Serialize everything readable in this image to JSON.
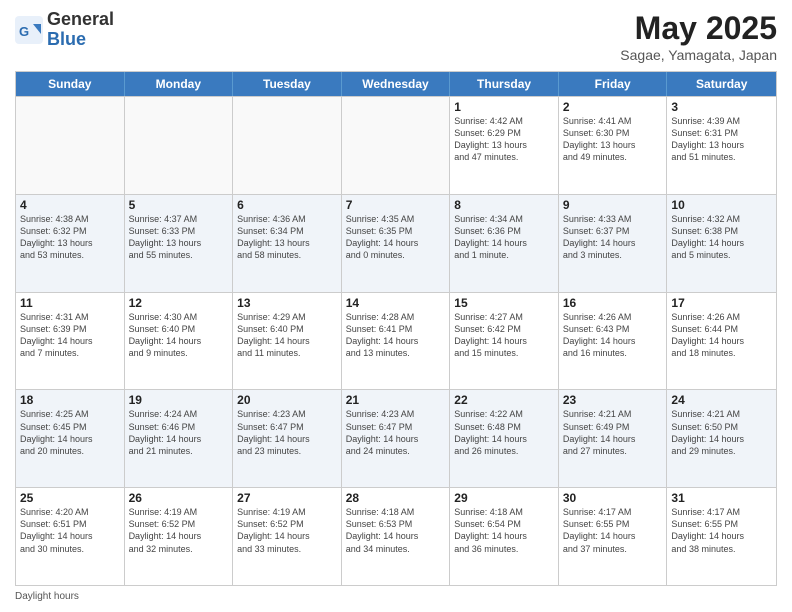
{
  "header": {
    "logo_general": "General",
    "logo_blue": "Blue",
    "title": "May 2025",
    "subtitle": "Sagae, Yamagata, Japan"
  },
  "weekdays": [
    "Sunday",
    "Monday",
    "Tuesday",
    "Wednesday",
    "Thursday",
    "Friday",
    "Saturday"
  ],
  "weeks": [
    [
      {
        "day": "",
        "info": "",
        "empty": true
      },
      {
        "day": "",
        "info": "",
        "empty": true
      },
      {
        "day": "",
        "info": "",
        "empty": true
      },
      {
        "day": "",
        "info": "",
        "empty": true
      },
      {
        "day": "1",
        "info": "Sunrise: 4:42 AM\nSunset: 6:29 PM\nDaylight: 13 hours\nand 47 minutes."
      },
      {
        "day": "2",
        "info": "Sunrise: 4:41 AM\nSunset: 6:30 PM\nDaylight: 13 hours\nand 49 minutes."
      },
      {
        "day": "3",
        "info": "Sunrise: 4:39 AM\nSunset: 6:31 PM\nDaylight: 13 hours\nand 51 minutes."
      }
    ],
    [
      {
        "day": "4",
        "info": "Sunrise: 4:38 AM\nSunset: 6:32 PM\nDaylight: 13 hours\nand 53 minutes."
      },
      {
        "day": "5",
        "info": "Sunrise: 4:37 AM\nSunset: 6:33 PM\nDaylight: 13 hours\nand 55 minutes."
      },
      {
        "day": "6",
        "info": "Sunrise: 4:36 AM\nSunset: 6:34 PM\nDaylight: 13 hours\nand 58 minutes."
      },
      {
        "day": "7",
        "info": "Sunrise: 4:35 AM\nSunset: 6:35 PM\nDaylight: 14 hours\nand 0 minutes."
      },
      {
        "day": "8",
        "info": "Sunrise: 4:34 AM\nSunset: 6:36 PM\nDaylight: 14 hours\nand 1 minute."
      },
      {
        "day": "9",
        "info": "Sunrise: 4:33 AM\nSunset: 6:37 PM\nDaylight: 14 hours\nand 3 minutes."
      },
      {
        "day": "10",
        "info": "Sunrise: 4:32 AM\nSunset: 6:38 PM\nDaylight: 14 hours\nand 5 minutes."
      }
    ],
    [
      {
        "day": "11",
        "info": "Sunrise: 4:31 AM\nSunset: 6:39 PM\nDaylight: 14 hours\nand 7 minutes."
      },
      {
        "day": "12",
        "info": "Sunrise: 4:30 AM\nSunset: 6:40 PM\nDaylight: 14 hours\nand 9 minutes."
      },
      {
        "day": "13",
        "info": "Sunrise: 4:29 AM\nSunset: 6:40 PM\nDaylight: 14 hours\nand 11 minutes."
      },
      {
        "day": "14",
        "info": "Sunrise: 4:28 AM\nSunset: 6:41 PM\nDaylight: 14 hours\nand 13 minutes."
      },
      {
        "day": "15",
        "info": "Sunrise: 4:27 AM\nSunset: 6:42 PM\nDaylight: 14 hours\nand 15 minutes."
      },
      {
        "day": "16",
        "info": "Sunrise: 4:26 AM\nSunset: 6:43 PM\nDaylight: 14 hours\nand 16 minutes."
      },
      {
        "day": "17",
        "info": "Sunrise: 4:26 AM\nSunset: 6:44 PM\nDaylight: 14 hours\nand 18 minutes."
      }
    ],
    [
      {
        "day": "18",
        "info": "Sunrise: 4:25 AM\nSunset: 6:45 PM\nDaylight: 14 hours\nand 20 minutes."
      },
      {
        "day": "19",
        "info": "Sunrise: 4:24 AM\nSunset: 6:46 PM\nDaylight: 14 hours\nand 21 minutes."
      },
      {
        "day": "20",
        "info": "Sunrise: 4:23 AM\nSunset: 6:47 PM\nDaylight: 14 hours\nand 23 minutes."
      },
      {
        "day": "21",
        "info": "Sunrise: 4:23 AM\nSunset: 6:47 PM\nDaylight: 14 hours\nand 24 minutes."
      },
      {
        "day": "22",
        "info": "Sunrise: 4:22 AM\nSunset: 6:48 PM\nDaylight: 14 hours\nand 26 minutes."
      },
      {
        "day": "23",
        "info": "Sunrise: 4:21 AM\nSunset: 6:49 PM\nDaylight: 14 hours\nand 27 minutes."
      },
      {
        "day": "24",
        "info": "Sunrise: 4:21 AM\nSunset: 6:50 PM\nDaylight: 14 hours\nand 29 minutes."
      }
    ],
    [
      {
        "day": "25",
        "info": "Sunrise: 4:20 AM\nSunset: 6:51 PM\nDaylight: 14 hours\nand 30 minutes."
      },
      {
        "day": "26",
        "info": "Sunrise: 4:19 AM\nSunset: 6:52 PM\nDaylight: 14 hours\nand 32 minutes."
      },
      {
        "day": "27",
        "info": "Sunrise: 4:19 AM\nSunset: 6:52 PM\nDaylight: 14 hours\nand 33 minutes."
      },
      {
        "day": "28",
        "info": "Sunrise: 4:18 AM\nSunset: 6:53 PM\nDaylight: 14 hours\nand 34 minutes."
      },
      {
        "day": "29",
        "info": "Sunrise: 4:18 AM\nSunset: 6:54 PM\nDaylight: 14 hours\nand 36 minutes."
      },
      {
        "day": "30",
        "info": "Sunrise: 4:17 AM\nSunset: 6:55 PM\nDaylight: 14 hours\nand 37 minutes."
      },
      {
        "day": "31",
        "info": "Sunrise: 4:17 AM\nSunset: 6:55 PM\nDaylight: 14 hours\nand 38 minutes."
      }
    ]
  ],
  "footer": {
    "daylight_label": "Daylight hours"
  }
}
